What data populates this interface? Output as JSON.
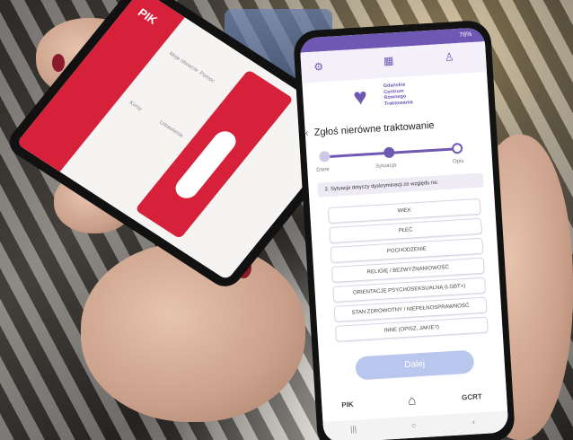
{
  "left_phone": {
    "logo": "PIK",
    "tiles": [
      "Moje otwarcie",
      "Kursy",
      "Pomoc",
      "Ustawienia"
    ]
  },
  "right_phone": {
    "status": "76%",
    "brand_lines": [
      "Gdańskie",
      "Centrum",
      "Równego",
      "Traktowania"
    ],
    "title": "Zgłoś nierówne traktowanie",
    "steps": [
      "Dane",
      "Sytuacja",
      "Opis"
    ],
    "question": "2. Sytuacja dotyczy dyskryminacji ze względu na:",
    "options": [
      "WIEK",
      "PŁEĆ",
      "POCHODZENIE",
      "RELIGIĘ / BEZWYZNANIOWOŚĆ",
      "ORIENTACJĘ PSYCHOSEKSUALNĄ (LGBT+)",
      "STAN ZDROWOTNY / NIEPEŁNOSPRAWNOŚĆ",
      "INNE (OPISZ, JAKIE?)"
    ],
    "next_label": "Dalej",
    "bottom_nav": {
      "left": "PIK",
      "right": "GCRT"
    },
    "accent": "#6f58b3",
    "button_color": "#b9c6ee"
  }
}
